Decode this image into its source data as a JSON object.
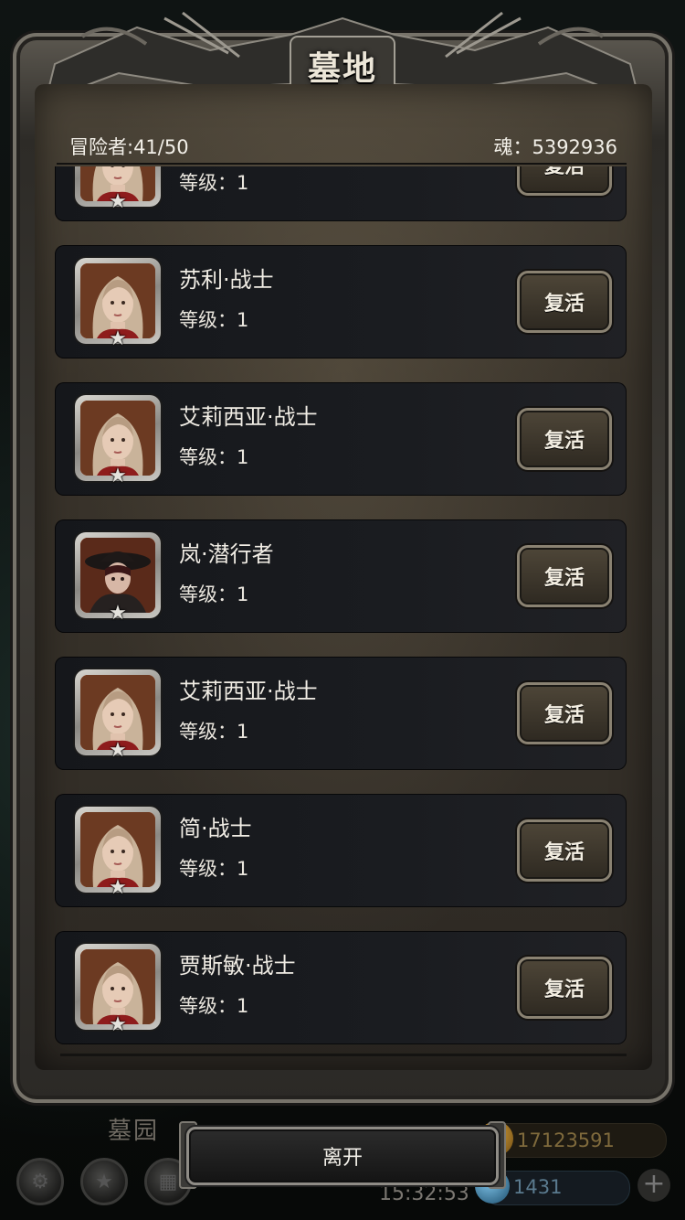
{
  "dialog": {
    "title": "墓地",
    "adventurers_label": "冒险者:41/50",
    "souls_label": "魂：5392936",
    "revive_label": "复活",
    "leave_label": "离开"
  },
  "list": {
    "partial_top": {
      "level": "等级：1"
    },
    "items": [
      {
        "name": "苏利·战士",
        "level": "等级：1",
        "portrait": "female-warrior"
      },
      {
        "name": "艾莉西亚·战士",
        "level": "等级：1",
        "portrait": "female-warrior"
      },
      {
        "name": "岚·潜行者",
        "level": "等级：1",
        "portrait": "hooded-rogue"
      },
      {
        "name": "艾莉西亚·战士",
        "level": "等级：1",
        "portrait": "female-warrior"
      },
      {
        "name": "简·战士",
        "level": "等级：1",
        "portrait": "female-warrior"
      },
      {
        "name": "贾斯敏·战士",
        "level": "等级：1",
        "portrait": "female-warrior"
      }
    ]
  },
  "hud": {
    "location": "墓园",
    "time": "15:32:53",
    "gold": "17123591",
    "gems": "1431"
  },
  "colors": {
    "portrait_border": "#c9561f",
    "frame_metal": "#77736a",
    "parchment": "#3a342b"
  }
}
